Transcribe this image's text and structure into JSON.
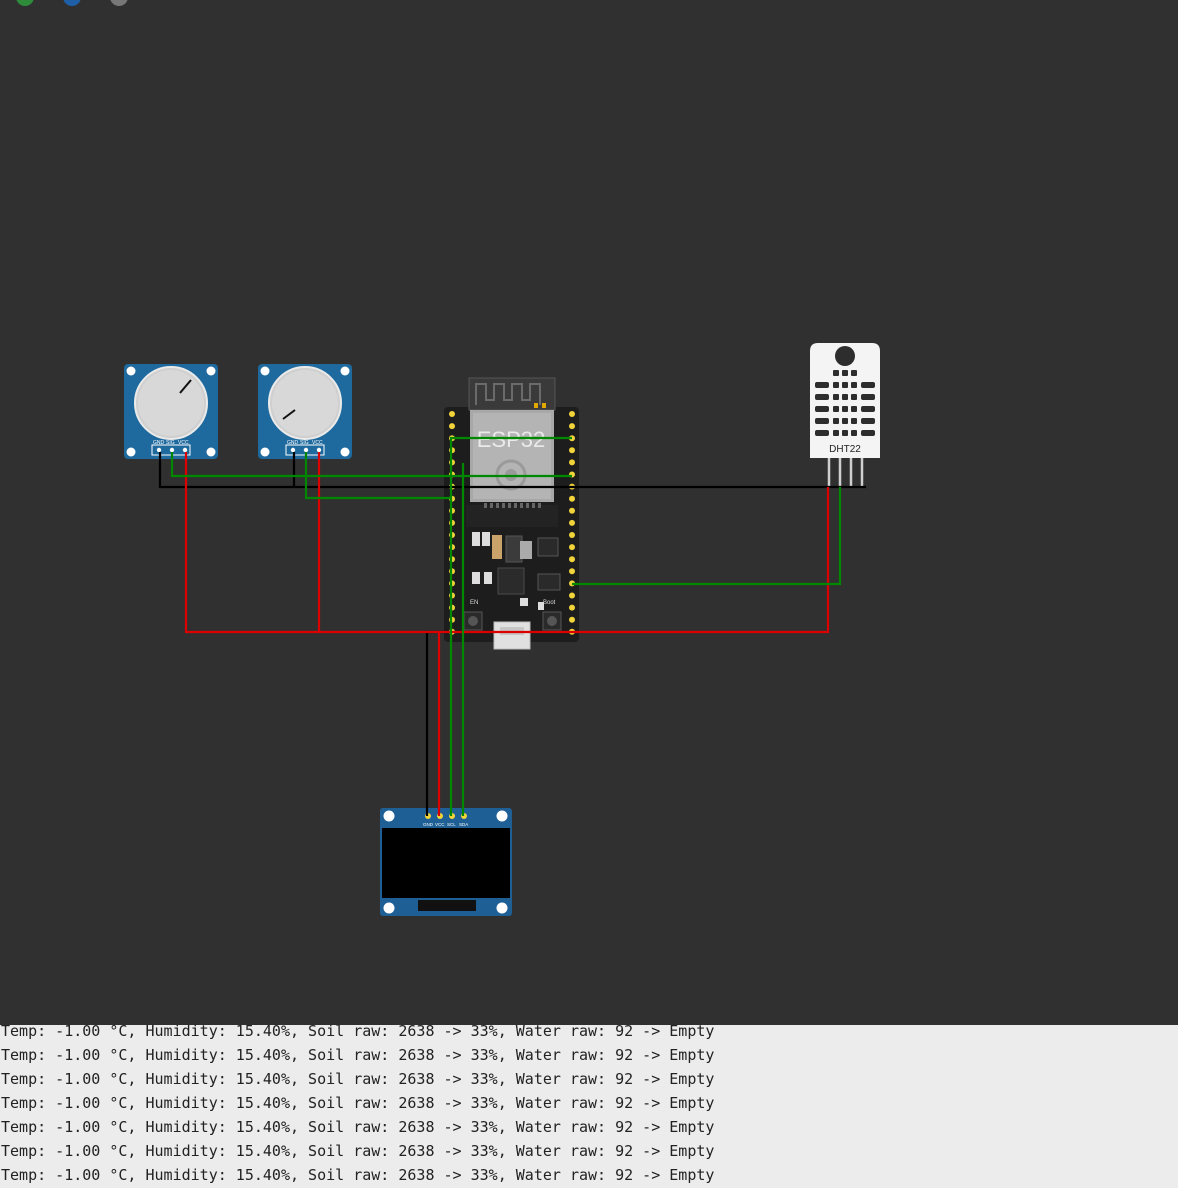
{
  "toolbar": {
    "buttons": [
      {
        "icon": "play-icon",
        "color": "#2e8b3a"
      },
      {
        "icon": "stop-icon",
        "color": "#1f5fa8"
      },
      {
        "icon": "pause-icon",
        "color": "#777777"
      }
    ]
  },
  "components": {
    "mcu_label": "ESP32",
    "dht_label": "DHT22",
    "pot_pins": [
      "GND",
      "SIG",
      "VCC"
    ],
    "oled_pins": [
      "GND",
      "VCC",
      "SCL",
      "SDA"
    ],
    "en_label": "EN",
    "boot_label": "Boot"
  },
  "colors": {
    "wire_gnd": "#000000",
    "wire_vcc": "#dd0000",
    "wire_signal": "#008800",
    "board_blue": "#1e6a9e",
    "pin_gold": "#f1d33a"
  },
  "serial_monitor": {
    "lines": [
      "Temp: -1.00 °C, Humidity: 15.40%, Soil raw: 2638 -> 33%, Water raw: 92 -> Empty",
      "Temp: -1.00 °C, Humidity: 15.40%, Soil raw: 2638 -> 33%, Water raw: 92 -> Empty",
      "Temp: -1.00 °C, Humidity: 15.40%, Soil raw: 2638 -> 33%, Water raw: 92 -> Empty",
      "Temp: -1.00 °C, Humidity: 15.40%, Soil raw: 2638 -> 33%, Water raw: 92 -> Empty",
      "Temp: -1.00 °C, Humidity: 15.40%, Soil raw: 2638 -> 33%, Water raw: 92 -> Empty",
      "Temp: -1.00 °C, Humidity: 15.40%, Soil raw: 2638 -> 33%, Water raw: 92 -> Empty",
      "Temp: -1.00 °C, Humidity: 15.40%, Soil raw: 2638 -> 33%, Water raw: 92 -> Empty"
    ]
  }
}
